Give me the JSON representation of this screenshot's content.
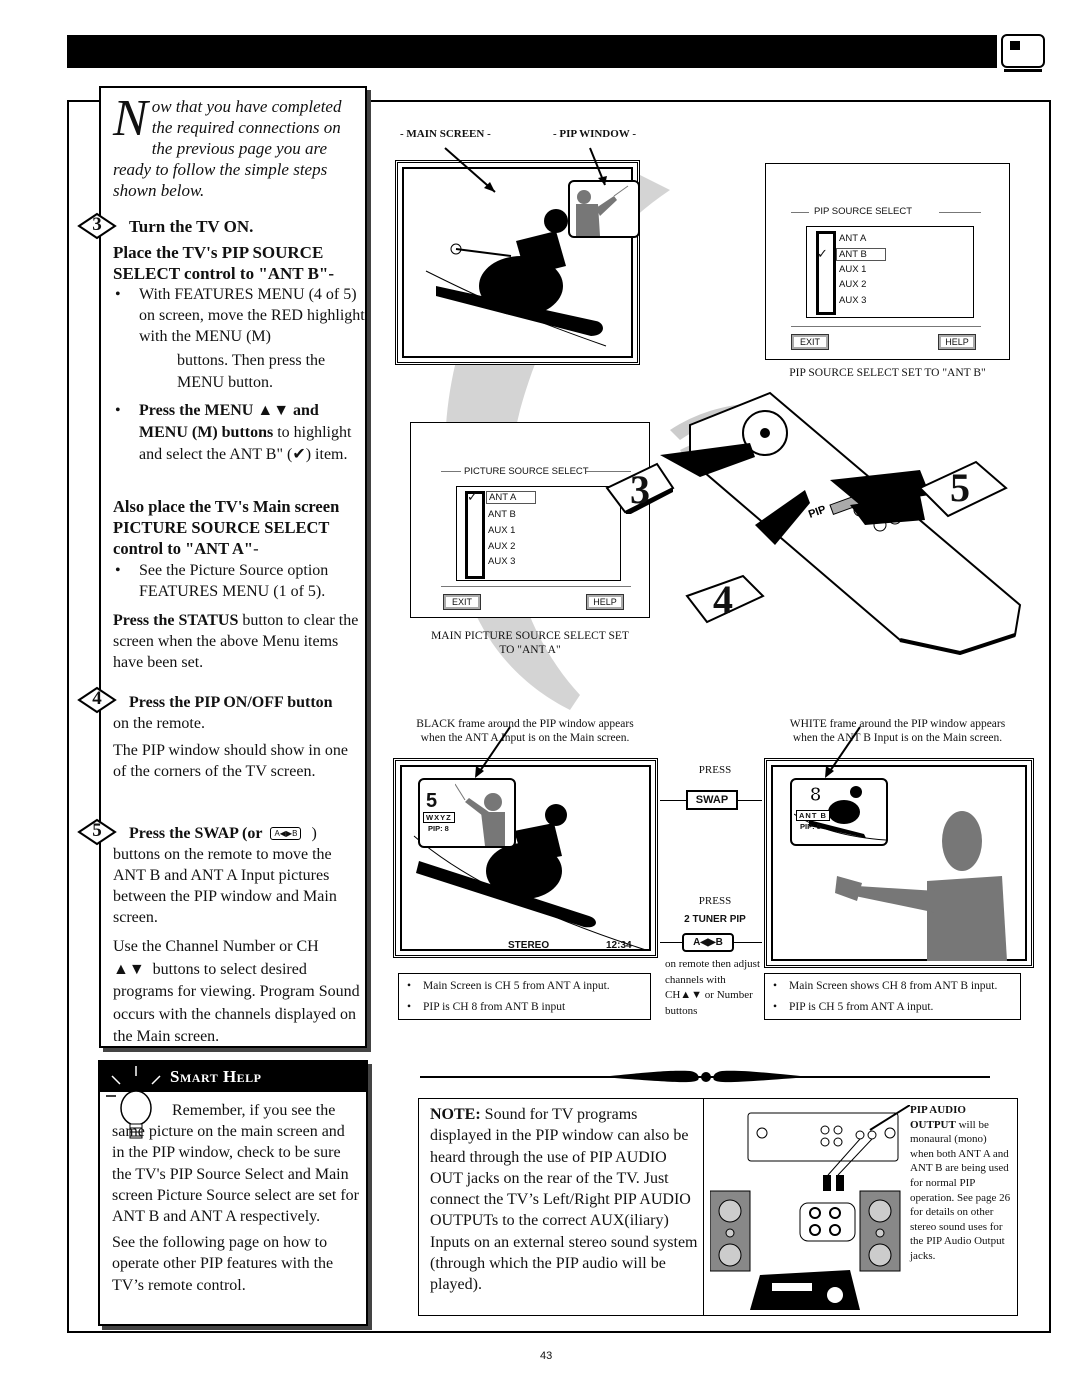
{
  "header": {
    "tv_icon": "tv-icon"
  },
  "intro": {
    "dropcap": "N",
    "text": "ow that you have completed the required connections on the previous page you are ready to follow the simple steps shown below."
  },
  "steps": [
    {
      "number": "3",
      "heading": "Turn the TV ON.",
      "subheading": "Place the TV's PIP SOURCE SELECT control to \"ANT B\"-",
      "bullets": [
        "With FEATURES MENU (4 of 5) on screen, move the RED highlight with the MENU (M)",
        "buttons. Then press the MENU button."
      ],
      "bullet2_bold": "Press the MENU ▲▼ and MENU (M) buttons",
      "bullet2_rest": " to highlight and select the ANT B\" (✔) item.",
      "also_heading": "Also place the TV's Main screen PICTURE SOURCE SELECT control to \"ANT A\"",
      "also_dash": "-",
      "also_bullet": "See the Picture Source option FEATURES MENU (1 of 5).",
      "status_bold": "Press the STATUS",
      "status_rest": " button to clear the screen when the above Menu items have been set."
    },
    {
      "number": "4",
      "heading": "Press the PIP ON/OFF button",
      "rest": "on the remote.",
      "para": "The PIP window should show in one of the corners of the TV screen."
    },
    {
      "number": "5",
      "heading": "Press the SWAP (or",
      "icon_label": "A◀▶B",
      "heading_end": ")",
      "rest": "buttons on the remote to move the ANT B and ANT A Input pictures between the PIP window and Main screen.",
      "para_ch": "Use the Channel Number or CH",
      "para_arrows": "▲▼",
      "para_rest": "buttons to select desired programs for viewing. Program Sound occurs with the channels displayed on the Main screen."
    }
  ],
  "smart_help": {
    "title": "Smart Help",
    "para1": "Remember, if you see the same picture on the main screen and in the PIP window, check to be sure the TV's PIP Source Select and Main screen Picture Source select are set for ANT B and ANT A respectively.",
    "para2": "See the following page on how to operate other PIP features with the TV’s remote control."
  },
  "top_diagram": {
    "main_screen_label": "- MAIN SCREEN -",
    "pip_window_label": "- PIP WINDOW -"
  },
  "pip_source_dialog": {
    "title": "PIP SOURCE SELECT",
    "items": [
      "ANT A",
      "ANT B",
      "AUX 1",
      "AUX 2",
      "AUX 3"
    ],
    "selected": "ANT B",
    "exit": "EXIT",
    "help": "HELP",
    "caption": "PIP SOURCE SELECT SET TO \"ANT B\""
  },
  "picture_source_dialog": {
    "title": "PICTURE SOURCE SELECT",
    "items": [
      "ANT A",
      "ANT B",
      "AUX 1",
      "AUX 2",
      "AUX 3"
    ],
    "selected": "ANT A",
    "exit": "EXIT",
    "help": "HELP",
    "caption_line1": "MAIN PICTURE SOURCE SELECT SET",
    "caption_line2": "TO \"ANT A\""
  },
  "remote_callouts": [
    "3",
    "4",
    "5"
  ],
  "remote_pip_label": "PIP",
  "swap_diagram": {
    "left_caption_line1": "BLACK frame around the PIP window appears",
    "left_caption_line2": "when the ANT A Input is on the Main screen.",
    "right_caption_line1": "WHITE frame around the PIP window appears",
    "right_caption_line2": "when the ANT B Input is on the Main screen.",
    "left_pip_channel": "5",
    "left_pip_station": "WXYZ",
    "left_pip_label": "PIP: 8",
    "left_status": "STEREO",
    "left_time": "12:34",
    "right_pip_channel": "8",
    "right_pip_station": "ANT B",
    "right_pip_label": "PIP: 5",
    "press1": "PRESS",
    "swap_button": "SWAP",
    "press2": "PRESS",
    "tuner_pip": "2 TUNER PIP",
    "ab_button": "A◀▶B",
    "remote_note": "on remote then adjust channels with CH▲▼ or Number buttons",
    "left_info": [
      "Main Screen is CH 5 from ANT A input.",
      "PIP is CH 8 from ANT B input"
    ],
    "right_info": [
      "Main Screen shows CH 8 from ANT B input.",
      "PIP is CH 5 from ANT A input."
    ]
  },
  "note": {
    "bold": "NOTE:",
    "text": " Sound for TV programs displayed in the PIP window can also be heard through the use of PIP AUDIO OUT jacks on the rear of the TV. Just connect the TV’s Left/Right PIP AUDIO OUTPUTs to the correct AUX(iliary) Inputs on an external stereo sound system (through which the PIP audio will be played).",
    "pip_audio_bold": "PIP AUDIO OUTPUT",
    "pip_audio_text": " will be monaural (mono) when both ANT A and ANT B are being used for normal PIP operation. See page 26 for details on other stereo sound uses for the PIP Audio Output jacks."
  },
  "page_number": "43"
}
